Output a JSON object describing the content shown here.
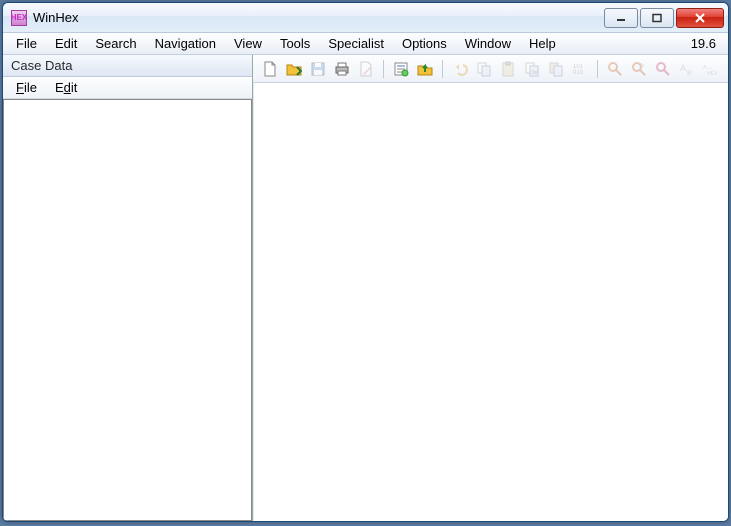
{
  "titlebar": {
    "title": "WinHex"
  },
  "menubar": {
    "items": [
      "File",
      "Edit",
      "Search",
      "Navigation",
      "View",
      "Tools",
      "Specialist",
      "Options",
      "Window",
      "Help"
    ],
    "version": "19.6"
  },
  "side_panel": {
    "title": "Case Data",
    "menu": {
      "file": "File",
      "edit": "Edit"
    }
  },
  "toolbar": {
    "icons": {
      "new": "new-file-icon",
      "open": "open-folder-icon",
      "save": "save-icon",
      "print": "print-icon",
      "write": "write-icon",
      "props": "properties-icon",
      "folder_up": "folder-up-icon",
      "undo": "undo-icon",
      "copy_block": "copy-block-icon",
      "clipboard": "clipboard-icon",
      "copy_hex": "copy-hex-icon",
      "paste_hex": "paste-hex-icon",
      "hexnum": "hex-values-icon",
      "find": "find-icon",
      "find_hex": "find-hex-icon",
      "find_text": "find-text-icon",
      "replace": "replace-icon",
      "replace_hex": "replace-hex-icon"
    }
  }
}
